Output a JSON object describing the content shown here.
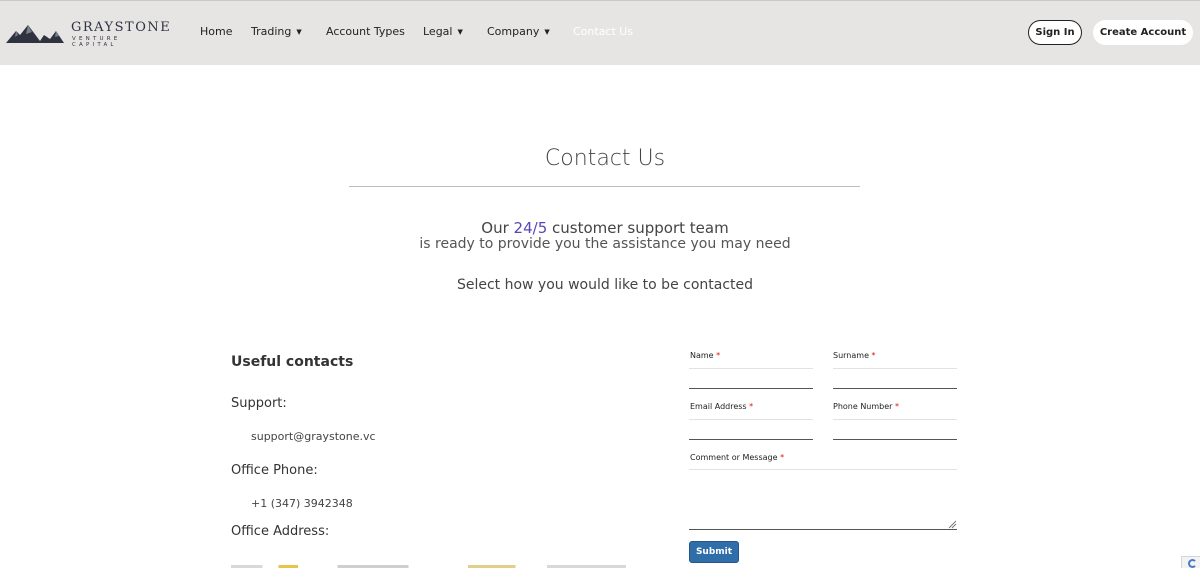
{
  "brand": {
    "name": "GRAYSTONE",
    "tagline": "VENTURE CAPITAL"
  },
  "nav": {
    "home": "Home",
    "trading": "Trading",
    "account_types": "Account Types",
    "legal": "Legal",
    "company": "Company",
    "contact_us": "Contact Us",
    "caret": "▼"
  },
  "auth": {
    "sign_in": "Sign In",
    "create_account": "Create Account"
  },
  "hero": {
    "title": "Contact Us",
    "support_prefix": "Our ",
    "support_highlight": "24/5",
    "support_suffix": " customer support team",
    "support_line2": "is ready to provide you the assistance you may need",
    "select_prompt": "Select how you would like to be contacted"
  },
  "contacts": {
    "heading": "Useful contacts",
    "support_label": "Support:",
    "support_value": "support@graystone.vc",
    "phone_label": "Office Phone:",
    "phone_value": "+1 (347) 3942348",
    "address_label": "Office Address:"
  },
  "form": {
    "required_mark": "*",
    "name_label": "Name",
    "surname_label": "Surname",
    "email_label": "Email Address",
    "phone_label": "Phone Number",
    "comment_label": "Comment or Message",
    "submit": "Submit"
  },
  "colors": {
    "header_bg": "#e6e5e4",
    "highlight": "#5a46b8",
    "submit_bg": "#2f6ea8",
    "required": "#dd1111"
  }
}
